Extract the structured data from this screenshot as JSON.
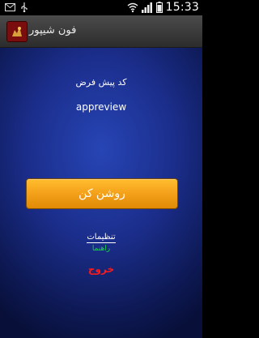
{
  "status_bar": {
    "time": "15:33",
    "left_icons": [
      "mail-icon",
      "usb-icon"
    ],
    "right_icons": [
      "wifi-icon",
      "signal-icon",
      "battery-icon"
    ]
  },
  "app_bar": {
    "title": "فون شیپور",
    "icon": "app-logo-icon"
  },
  "main": {
    "code_label": "کد پیش فرض",
    "code_value": "appreview",
    "power_button_label": "روشن کن",
    "settings_link": "تنظیمات",
    "help_link": "راهنما",
    "exit_link": "خروج"
  },
  "colors": {
    "background": "#1b2e8c",
    "button": "#f4a01a",
    "help": "#1fd14b",
    "exit": "#ff1a1a"
  }
}
